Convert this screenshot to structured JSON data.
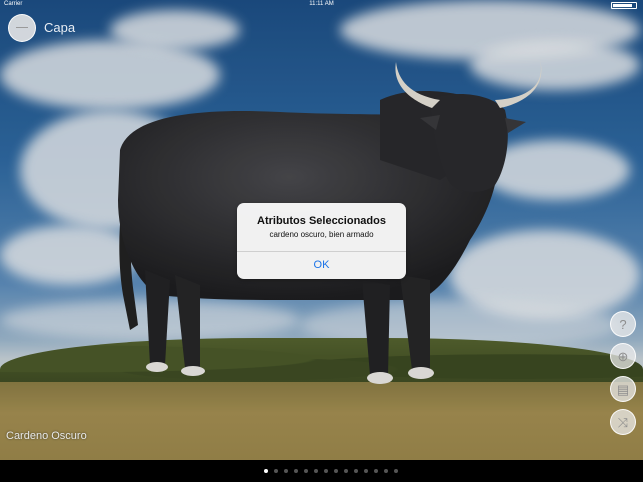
{
  "statusbar": {
    "carrier": "Carrier",
    "time": "11:11 AM"
  },
  "header": {
    "title": "Capa"
  },
  "alert": {
    "title": "Atributos Seleccionados",
    "message": "cardeno oscuro, bien armado",
    "ok_label": "OK"
  },
  "side_buttons": [
    {
      "icon": "help-icon",
      "glyph": "?"
    },
    {
      "icon": "info-icon",
      "glyph": "⊕"
    },
    {
      "icon": "card-icon",
      "glyph": "▤"
    },
    {
      "icon": "shuffle-icon",
      "glyph": "⤨"
    }
  ],
  "caption": "Cardeno Oscuro",
  "pager": {
    "count": 14,
    "active": 1
  },
  "colors": {
    "alert_button": "#1a73e8",
    "sky": "#2f6aa3",
    "field": "#a48f52",
    "bull": "#2b2b2e"
  }
}
